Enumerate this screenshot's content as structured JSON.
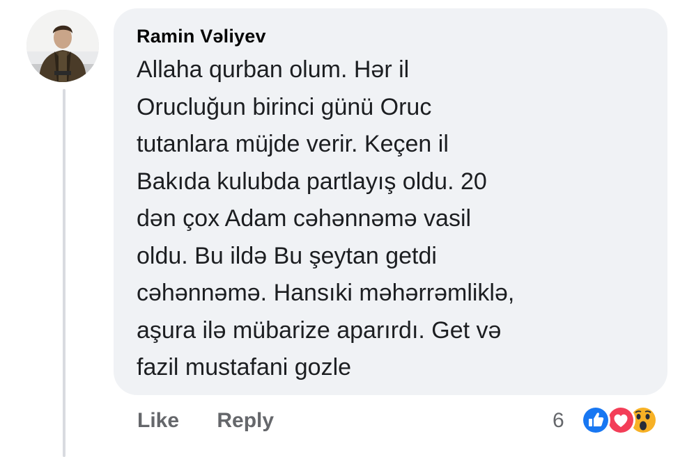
{
  "comment": {
    "author": "Ramin Vəliyev",
    "text": "Allaha qurban olum. Hər il\nOrucluğun birinci günü Oruc\ntutanlara müjde verir. Keçen il\nBakıda kulubda partlayış oldu. 20\ndən çox Adam cəhənnəmə vasil\noldu. Bu ildə Bu şeytan getdi\ncəhənnəmə. Hansıki məhərrəmliklə,\naşura ilə mübarize aparırdı. Get və\nfazil mustafani gozle"
  },
  "actions": {
    "like_label": "Like",
    "reply_label": "Reply"
  },
  "reactions": {
    "count": "6",
    "icons": [
      "like-icon",
      "love-icon",
      "wow-icon"
    ],
    "colors": {
      "like": "#1877f2",
      "love": "#f33e58",
      "wow": "#f7b125"
    }
  }
}
